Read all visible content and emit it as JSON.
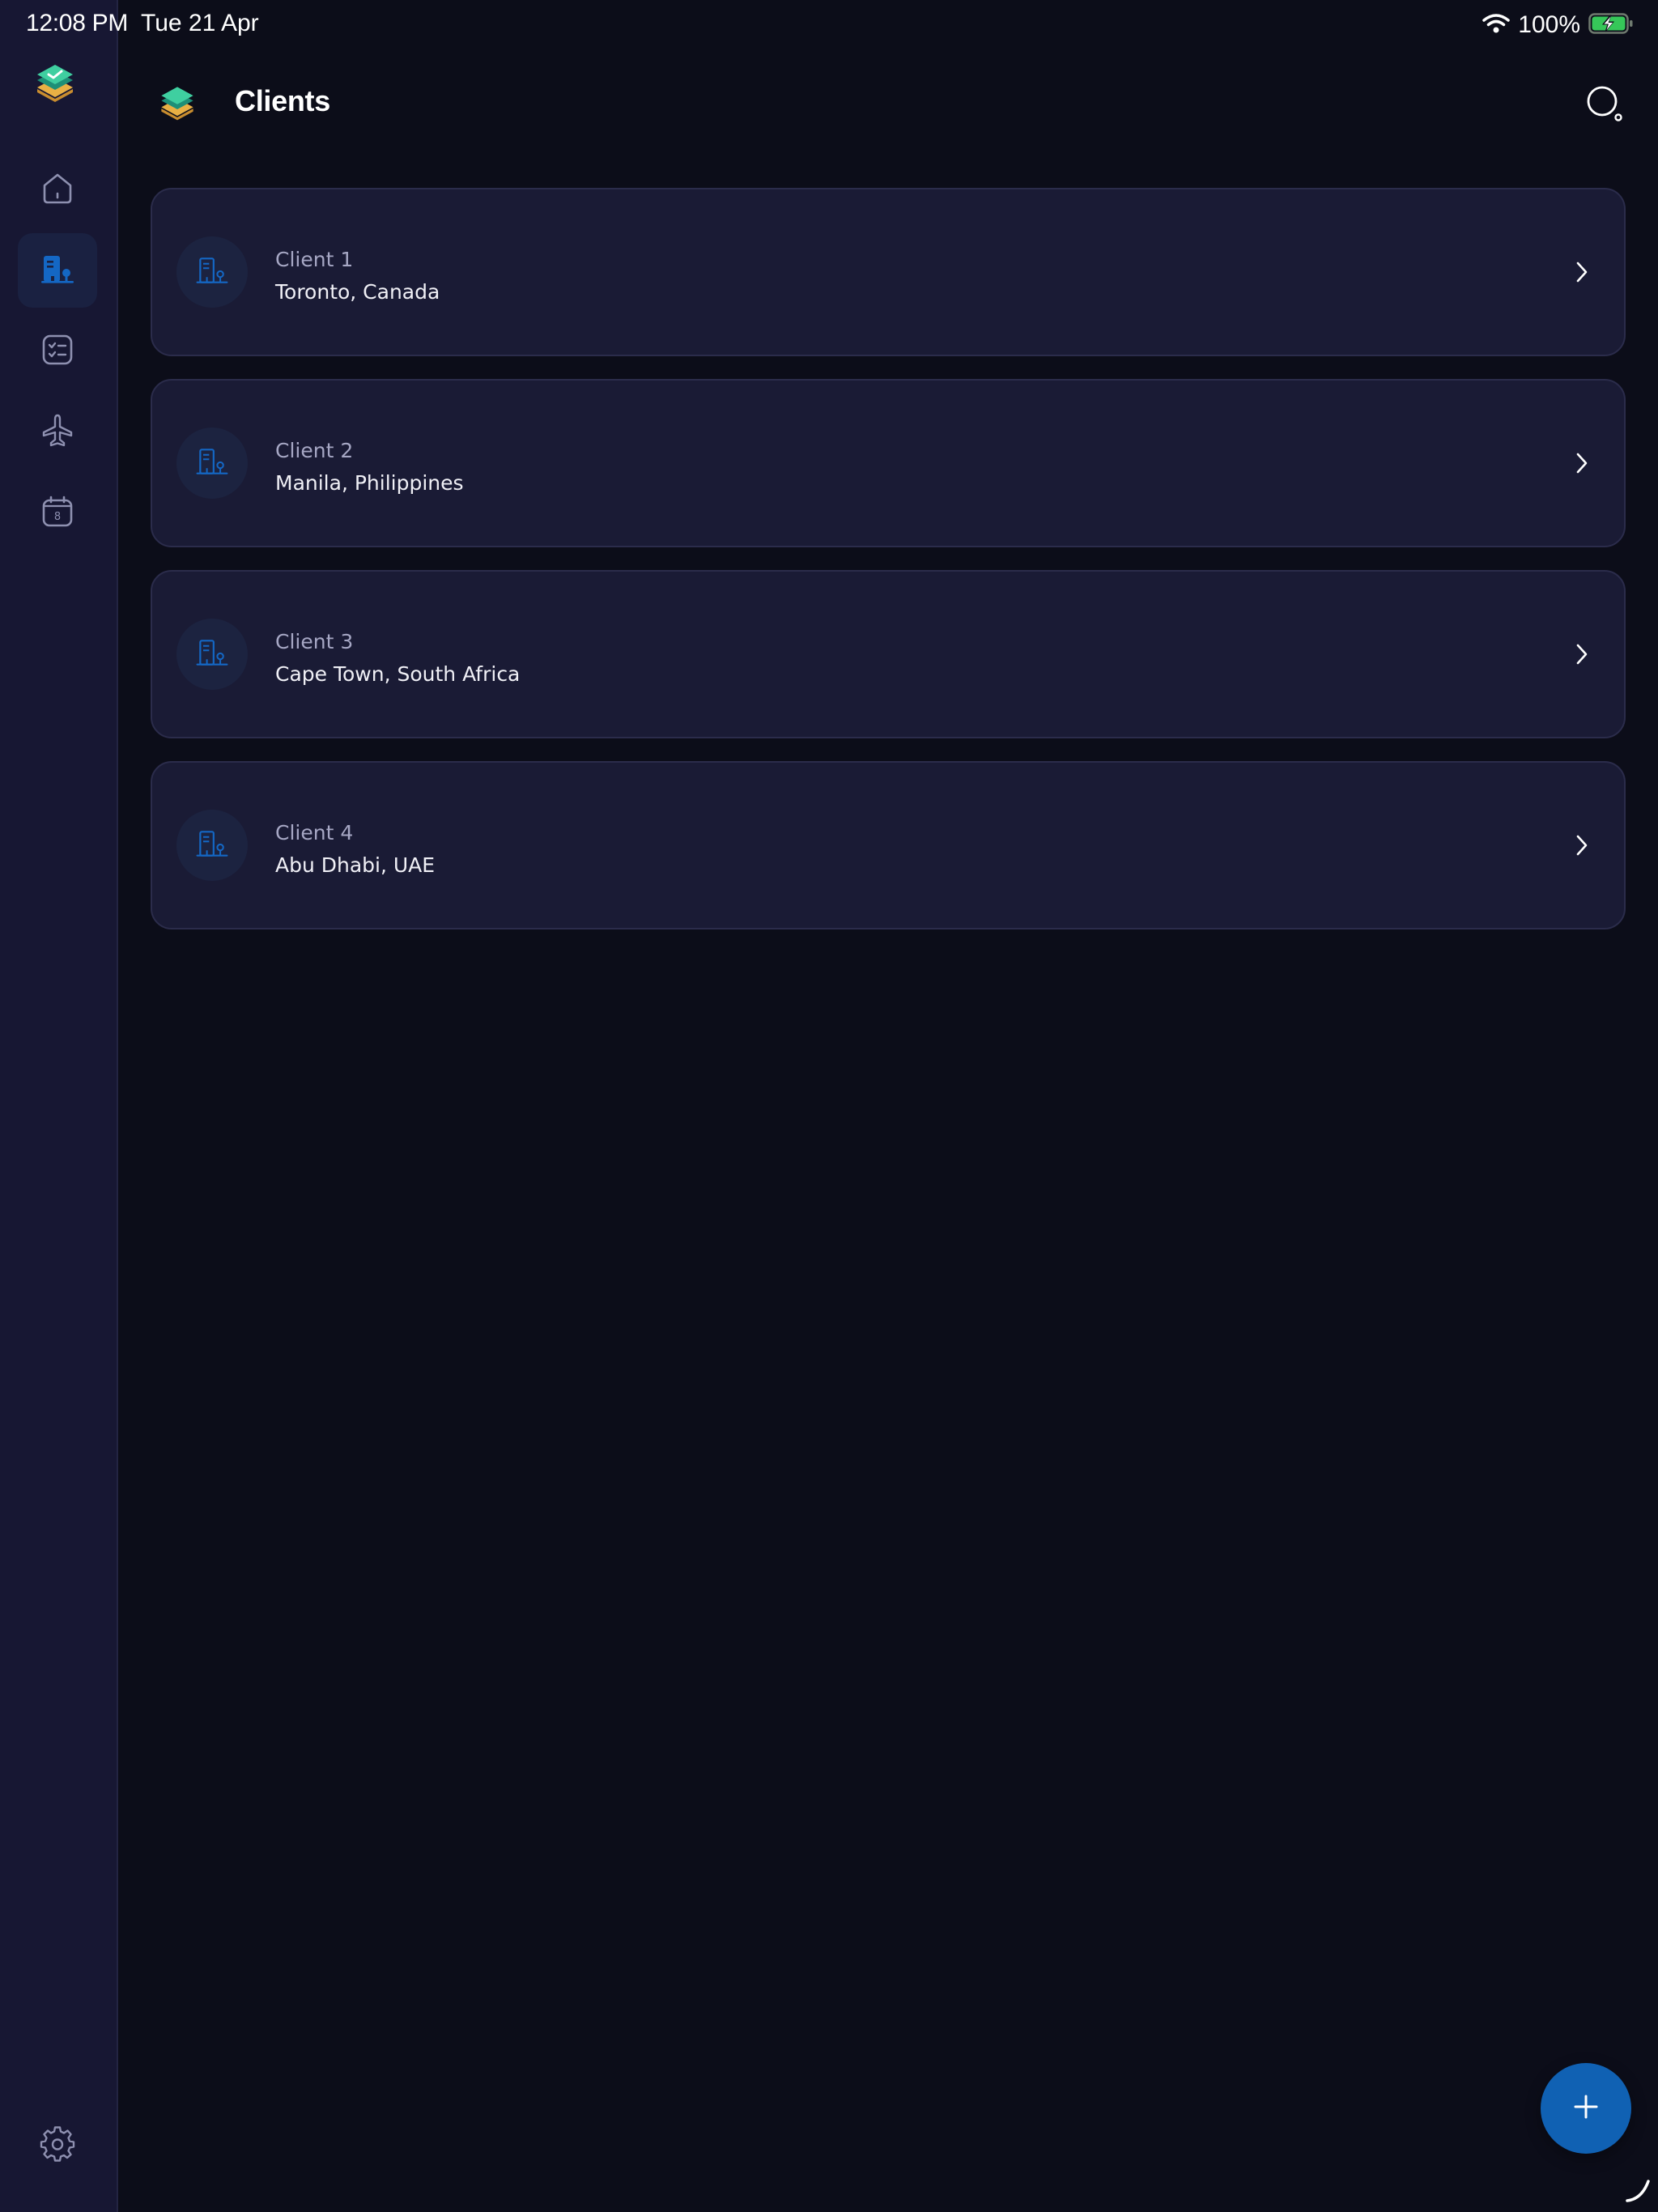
{
  "status_bar": {
    "time": "12:08 PM",
    "date": "Tue 21 Apr",
    "battery": "100%"
  },
  "header": {
    "title": "Clients"
  },
  "sidebar": {
    "items": [
      {
        "name": "home",
        "icon": "home-icon",
        "active": false
      },
      {
        "name": "clients",
        "icon": "building-icon",
        "active": true
      },
      {
        "name": "tasks",
        "icon": "checklist-icon",
        "active": false
      },
      {
        "name": "travel",
        "icon": "airplane-icon",
        "active": false
      },
      {
        "name": "calendar",
        "icon": "calendar-icon",
        "active": false,
        "day": "8"
      }
    ],
    "settings_icon": "gear-icon"
  },
  "clients": [
    {
      "name": "Client 1",
      "location": "Toronto, Canada"
    },
    {
      "name": "Client 2",
      "location": "Manila, Philippines"
    },
    {
      "name": "Client 3",
      "location": "Cape Town, South Africa"
    },
    {
      "name": "Client 4",
      "location": "Abu Dhabi, UAE"
    }
  ],
  "fab": {
    "icon": "plus-icon"
  },
  "colors": {
    "background": "#0c0d19",
    "sidebar": "#171733",
    "card": "#1a1b35",
    "accent": "#1061b3",
    "logo_green": "#2fb98f",
    "logo_yellow": "#e9b044"
  }
}
